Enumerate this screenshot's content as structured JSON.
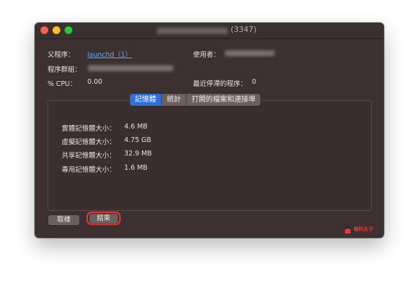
{
  "window": {
    "title_suffix": "(3347)"
  },
  "info": {
    "parent_label": "父程序：",
    "parent_value": "launchd（1）",
    "user_label": "使用者：",
    "group_label": "程序群組：",
    "cpu_label": "% CPU：",
    "cpu_value": "0.00",
    "recent_hangs_label": "最近停滯的程序：",
    "recent_hangs_value": "0"
  },
  "tabs": [
    {
      "label": "記憶體",
      "active": true
    },
    {
      "label": "統計",
      "active": false
    },
    {
      "label": "打開的檔案和連接埠",
      "active": false
    }
  ],
  "memory": [
    {
      "label": "實體記憶體大小：",
      "value": "4.6 MB"
    },
    {
      "label": "虛擬記憶體大小：",
      "value": "4.75 GB"
    },
    {
      "label": "共享記憶體大小：",
      "value": "32.9 MB"
    },
    {
      "label": "專用記憶體大小：",
      "value": "1.6 MB"
    }
  ],
  "buttons": {
    "cancel": "取樣",
    "quit": "結束"
  },
  "watermark": {
    "text": "塔科女子"
  },
  "colors": {
    "window_bg": "#3c3130",
    "active_tab": "#2f6fda",
    "highlight": "#e8373f",
    "link": "#6aa8ff"
  }
}
